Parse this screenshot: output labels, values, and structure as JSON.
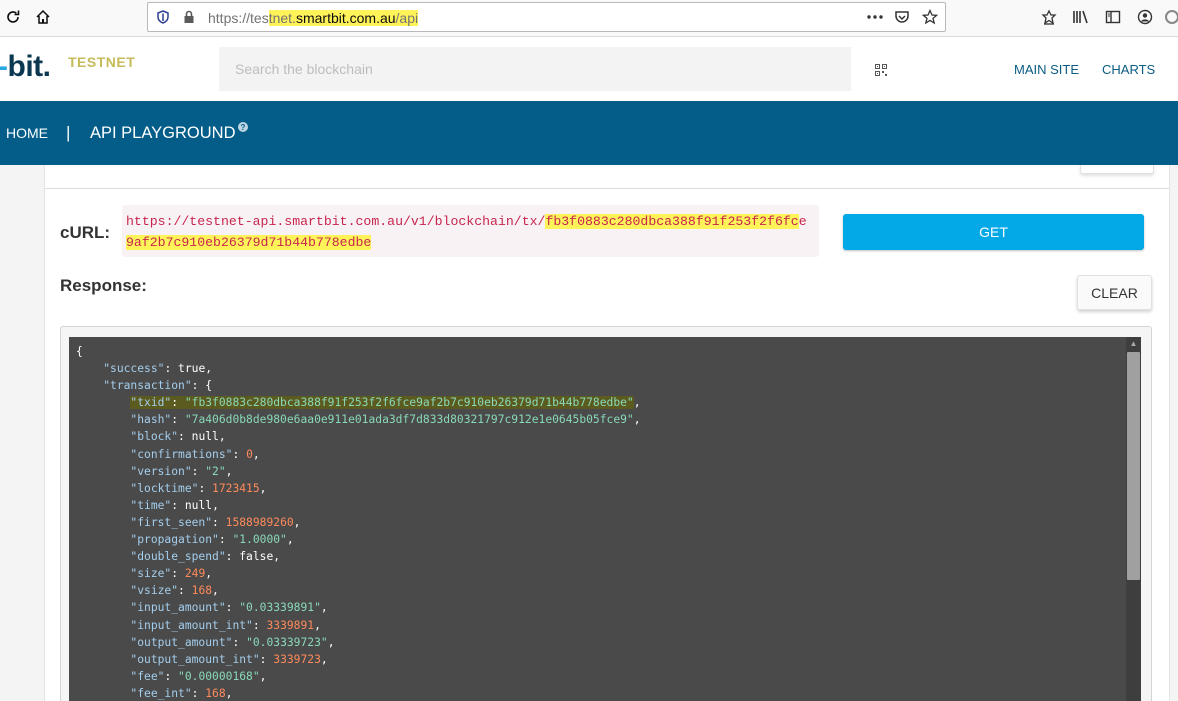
{
  "browser": {
    "url_prefix": "https://tes",
    "url_highlight_1": "tnet.",
    "url_domain": "smartbit.com.au",
    "url_path": "/api",
    "page_actions_icon": "dots-icon",
    "pocket_icon": "pocket-icon",
    "bookmark_icon": "star-icon"
  },
  "header": {
    "logo_dot": "-",
    "logo_text": "bit.",
    "network_label": "TESTNET",
    "search_placeholder": "Search the blockchain",
    "links": [
      "MAIN SITE",
      "CHARTS"
    ]
  },
  "nav": {
    "home": "HOME",
    "separator": "|",
    "api": "API PLAYGROUND",
    "help": "?"
  },
  "form": {
    "curl_label": "cURL:",
    "curl_line1_a": "https://testnet-api.smartbit.com.au/v1/blockchain/tx/",
    "curl_line1_b": "fb3f0883c280dbca388",
    "curl_line1_c": "f91f253f2f6fc",
    "curl_line1_d": "e",
    "curl_line2": "9af2b7c910eb26379d71b44b778edbe",
    "get_label": "GET",
    "response_label": "Response:",
    "clear_label": "CLEAR"
  },
  "response": {
    "lines": [
      {
        "type": "brace",
        "text": "{"
      },
      {
        "indent": "    ",
        "key": "\"success\"",
        "val": "true",
        "vt": "p",
        "tail": ","
      },
      {
        "indent": "    ",
        "key": "\"transaction\"",
        "val": "{",
        "vt": "p",
        "tail": ""
      },
      {
        "indent": "        ",
        "key": "\"txid\"",
        "val": "\"fb3f0883c280dbca388f91f253f2f6fce9af2b7c910eb26379d71b44b778edbe\"",
        "vt": "s",
        "tail": ",",
        "hl": true
      },
      {
        "indent": "        ",
        "key": "\"hash\"",
        "val": "\"7a406d0b8de980e6aa0e911e01ada3df7d833d80321797c912e1e0645b05fce9\"",
        "vt": "s",
        "tail": ","
      },
      {
        "indent": "        ",
        "key": "\"block\"",
        "val": "null",
        "vt": "p",
        "tail": ","
      },
      {
        "indent": "        ",
        "key": "\"confirmations\"",
        "val": "0",
        "vt": "n",
        "tail": ","
      },
      {
        "indent": "        ",
        "key": "\"version\"",
        "val": "\"2\"",
        "vt": "s",
        "tail": ","
      },
      {
        "indent": "        ",
        "key": "\"locktime\"",
        "val": "1723415",
        "vt": "n",
        "tail": ","
      },
      {
        "indent": "        ",
        "key": "\"time\"",
        "val": "null",
        "vt": "p",
        "tail": ","
      },
      {
        "indent": "        ",
        "key": "\"first_seen\"",
        "val": "1588989260",
        "vt": "n",
        "tail": ","
      },
      {
        "indent": "        ",
        "key": "\"propagation\"",
        "val": "\"1.0000\"",
        "vt": "s",
        "tail": ","
      },
      {
        "indent": "        ",
        "key": "\"double_spend\"",
        "val": "false",
        "vt": "p",
        "tail": ","
      },
      {
        "indent": "        ",
        "key": "\"size\"",
        "val": "249",
        "vt": "n",
        "tail": ","
      },
      {
        "indent": "        ",
        "key": "\"vsize\"",
        "val": "168",
        "vt": "n",
        "tail": ","
      },
      {
        "indent": "        ",
        "key": "\"input_amount\"",
        "val": "\"0.03339891\"",
        "vt": "s",
        "tail": ","
      },
      {
        "indent": "        ",
        "key": "\"input_amount_int\"",
        "val": "3339891",
        "vt": "n",
        "tail": ","
      },
      {
        "indent": "        ",
        "key": "\"output_amount\"",
        "val": "\"0.03339723\"",
        "vt": "s",
        "tail": ","
      },
      {
        "indent": "        ",
        "key": "\"output_amount_int\"",
        "val": "3339723",
        "vt": "n",
        "tail": ","
      },
      {
        "indent": "        ",
        "key": "\"fee\"",
        "val": "\"0.00000168\"",
        "vt": "s",
        "tail": ","
      },
      {
        "indent": "        ",
        "key": "\"fee_int\"",
        "val": "168",
        "vt": "n",
        "tail": ","
      }
    ]
  },
  "colors": {
    "nav_bg": "#035d88",
    "get_button": "#03a9e7",
    "code_bg": "#4a4a4a",
    "highlight": "#fff35a"
  }
}
